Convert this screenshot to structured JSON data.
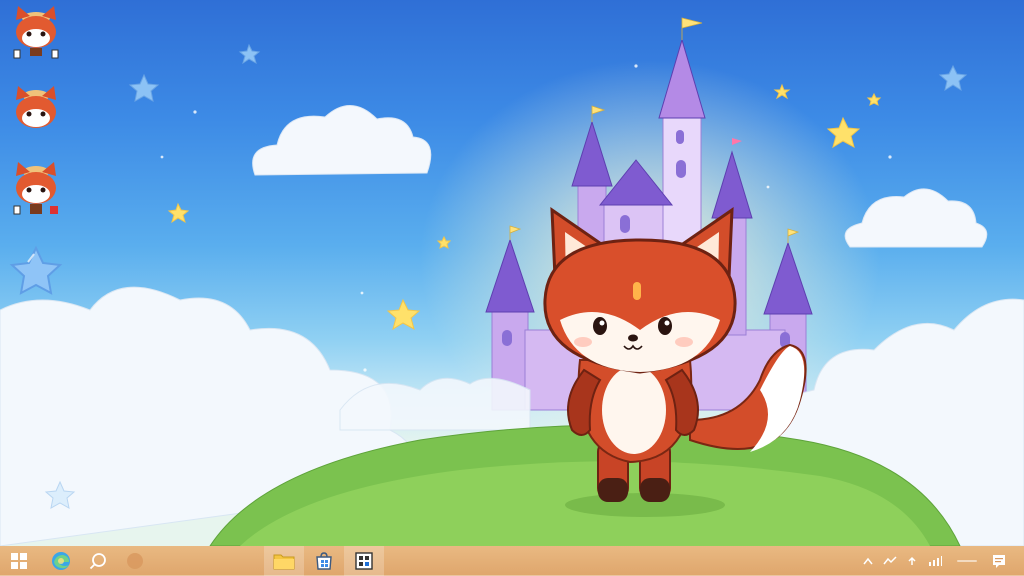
{
  "desktop": {
    "wallpaper": "fox-castle-clouds",
    "icons": [
      {
        "name": "fox-shortcut-1",
        "icon": "fox-icon"
      },
      {
        "name": "fox-shortcut-2",
        "icon": "fox-icon"
      },
      {
        "name": "fox-shortcut-3",
        "icon": "fox-icon"
      },
      {
        "name": "star-shortcut",
        "icon": "star-icon"
      }
    ]
  },
  "taskbar": {
    "start": {
      "icon": "windows-logo-icon"
    },
    "pinned": [
      "edge-icon",
      "search-icon",
      "cortana-icon"
    ],
    "apps": [
      "file-explorer-icon",
      "store-icon",
      "app-icon"
    ],
    "tray": [
      "chevron-up-icon",
      "network-icon",
      "upload-icon",
      "signal-icon",
      "notification-icon"
    ],
    "colors": {
      "bar": "#e2ab72",
      "active": "#f0c89a"
    }
  }
}
